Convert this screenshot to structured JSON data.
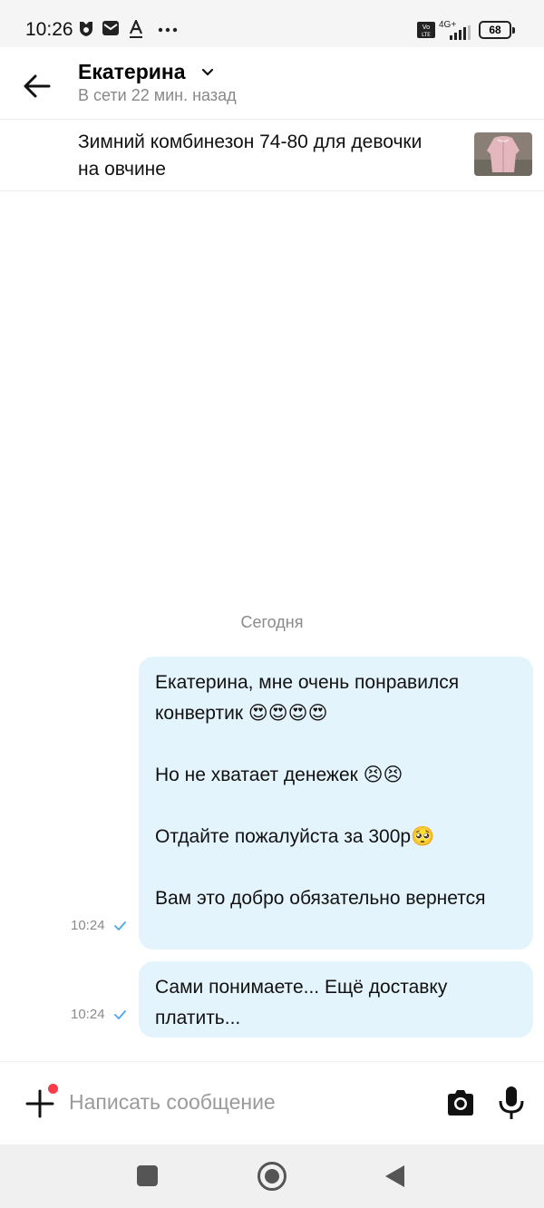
{
  "status_bar": {
    "time": "10:26",
    "network": "4G+",
    "battery": "68"
  },
  "header": {
    "contact_name": "Екатерина",
    "contact_status": "В сети 22 мин. назад"
  },
  "listing": {
    "title": "Зимний комбинезон 74-80 для девочки на овчине"
  },
  "chat": {
    "date_divider": "Сегодня",
    "messages": [
      {
        "text": "Екатерина, мне очень понравился конвертик 😍😍😍😍\n\nНо не хватает денежек 😣😣\n\nОтдайте пожалуйста за 300р🥺\n\nВам это добро обязательно вернется",
        "time": "10:24",
        "status": "sent"
      },
      {
        "text": "Сами понимаете... Ещё доставку платить...",
        "time": "10:24",
        "status": "sent"
      }
    ]
  },
  "composer": {
    "placeholder": "Написать сообщение"
  },
  "colors": {
    "bubble": "#e4f4fd",
    "check": "#4aa8e8",
    "notify_dot": "#ff3b4a"
  }
}
